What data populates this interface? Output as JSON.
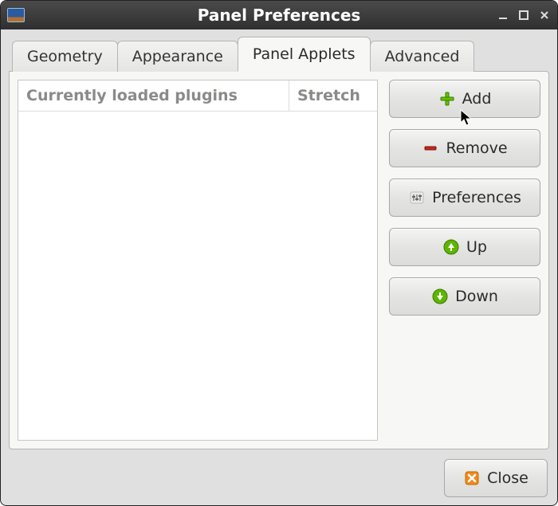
{
  "window": {
    "title": "Panel Preferences"
  },
  "tabs": {
    "geometry": "Geometry",
    "appearance": "Appearance",
    "applets": "Panel Applets",
    "advanced": "Advanced",
    "active": "applets"
  },
  "applets_page": {
    "columns": {
      "plugins": "Currently loaded plugins",
      "stretch": "Stretch"
    },
    "rows": []
  },
  "buttons": {
    "add": "Add",
    "remove": "Remove",
    "preferences": "Preferences",
    "up": "Up",
    "down": "Down",
    "close": "Close"
  },
  "icons": {
    "add": "plus-icon",
    "remove": "minus-icon",
    "preferences": "settings-icon",
    "up": "up-icon",
    "down": "down-icon",
    "close": "close-x-icon"
  }
}
